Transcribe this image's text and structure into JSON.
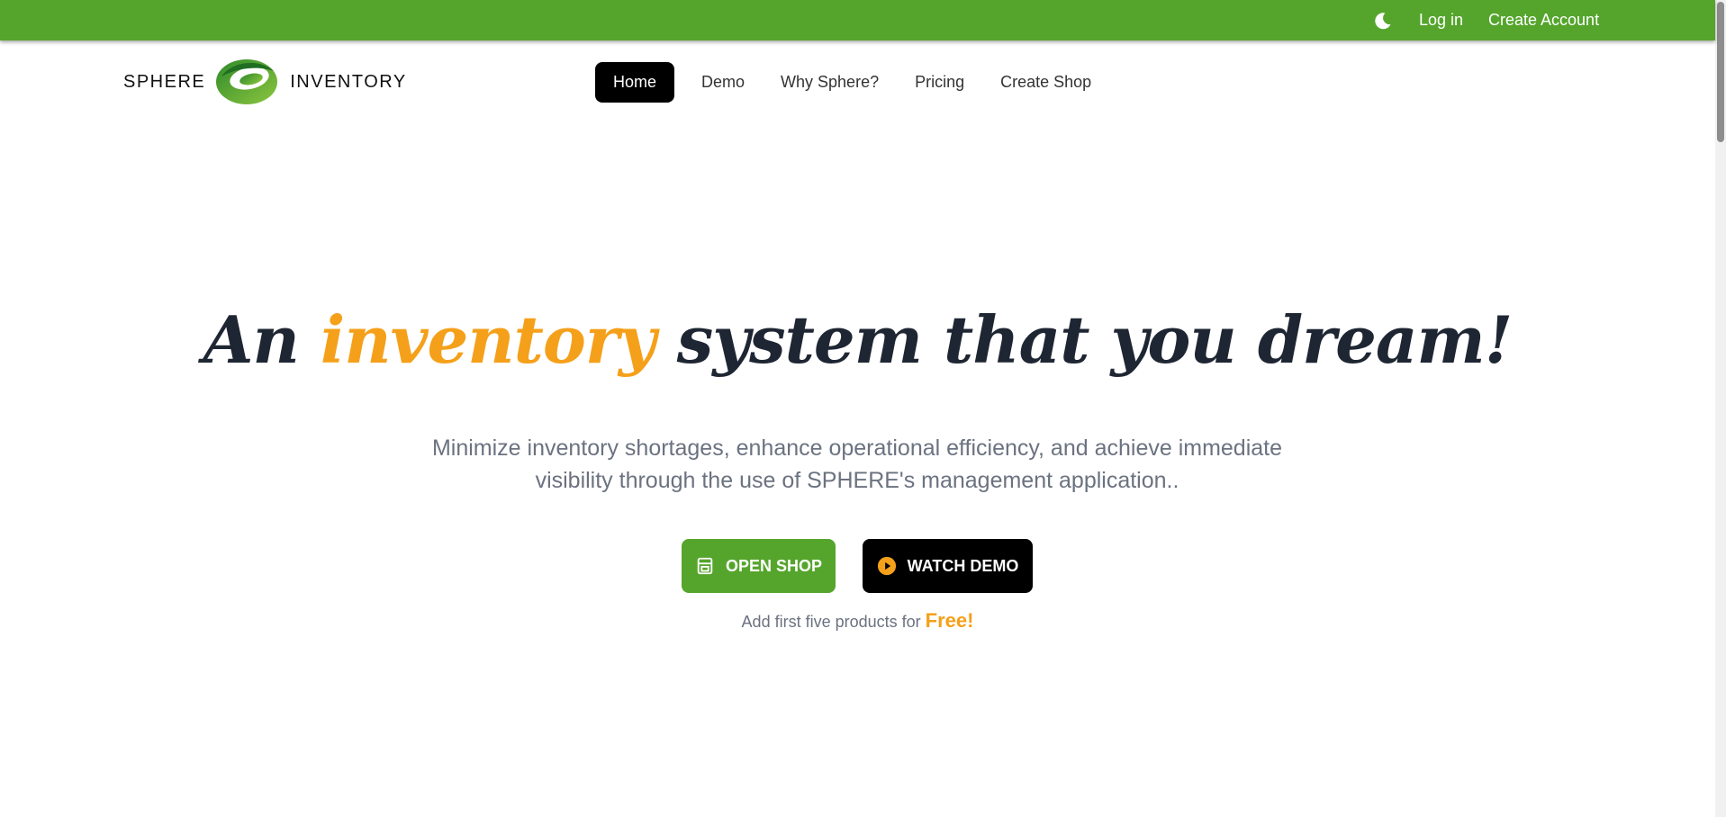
{
  "topbar": {
    "theme_icon": "moon-icon",
    "login": "Log in",
    "create_account": "Create Account",
    "bar_color": "#55a52c"
  },
  "logo": {
    "left_word": "SPHERE",
    "right_word": "INVENTORY",
    "mark_icon": "sphere-swirl-logo"
  },
  "nav": {
    "items": [
      {
        "label": "Home",
        "active": true
      },
      {
        "label": "Demo",
        "active": false
      },
      {
        "label": "Why Sphere?",
        "active": false
      },
      {
        "label": "Pricing",
        "active": false
      },
      {
        "label": "Create Shop",
        "active": false
      }
    ]
  },
  "hero": {
    "title_prefix": "An ",
    "title_accent": "inventory",
    "title_suffix": " system that you dream!",
    "subtitle_line1": "Minimize inventory shortages, enhance operational efficiency, and achieve immediate",
    "subtitle_line2": "visibility through the use of SPHERE's management application..",
    "open_shop_label": "OPEN SHOP",
    "open_shop_icon": "store-icon",
    "watch_demo_label": "WATCH DEMO",
    "watch_demo_icon": "play-circle-icon",
    "note_text": "Add first five products for ",
    "note_free": "Free!"
  },
  "colors": {
    "brand_green": "#55a52c",
    "accent_orange": "#f5a01a",
    "title_dark": "#1f2633"
  }
}
